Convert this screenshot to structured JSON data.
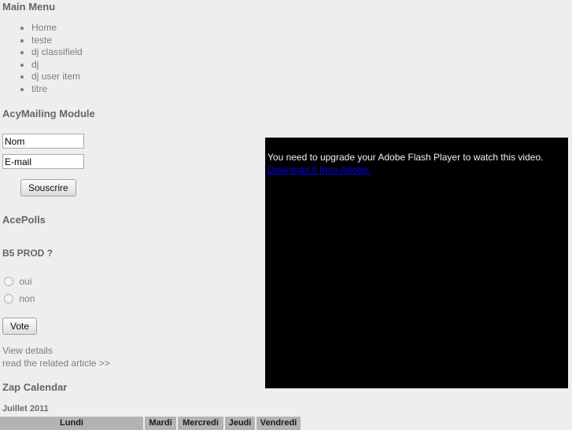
{
  "page": {
    "background_color": "#eeeeee",
    "text_color": "#7d7d7d",
    "heading_color": "#666666"
  },
  "main_menu": {
    "title": "Main Menu",
    "items": [
      {
        "label": "Home"
      },
      {
        "label": "teste"
      },
      {
        "label": "dj classifield"
      },
      {
        "label": "dj"
      },
      {
        "label": "dj user item"
      },
      {
        "label": "titre"
      }
    ]
  },
  "acymailing": {
    "title": "AcyMailing Module",
    "name_value": "Nom",
    "name_placeholder": "Nom",
    "email_value": "E-mail",
    "email_placeholder": "E-mail",
    "submit_label": "Souscrire"
  },
  "acepolls": {
    "title": "AcePolls",
    "question": "B5 PROD ?",
    "options": [
      {
        "label": "oui",
        "selected": false
      },
      {
        "label": "non",
        "selected": false
      }
    ],
    "vote_label": "Vote",
    "links": [
      {
        "label": "View details"
      },
      {
        "label": "read the related article >>"
      }
    ]
  },
  "calendar": {
    "title": "Zap Calendar",
    "month": "Juillet 2011",
    "day_headers": [
      "Lundi",
      "Mardi",
      "Mercredi",
      "Jeudi",
      "Vendredi"
    ]
  },
  "video": {
    "message": "You need to upgrade your Adobe Flash Player to watch this video.",
    "link_label": "Download it from Adobe.",
    "link_color": "#0000ee",
    "background_color": "#000000"
  }
}
